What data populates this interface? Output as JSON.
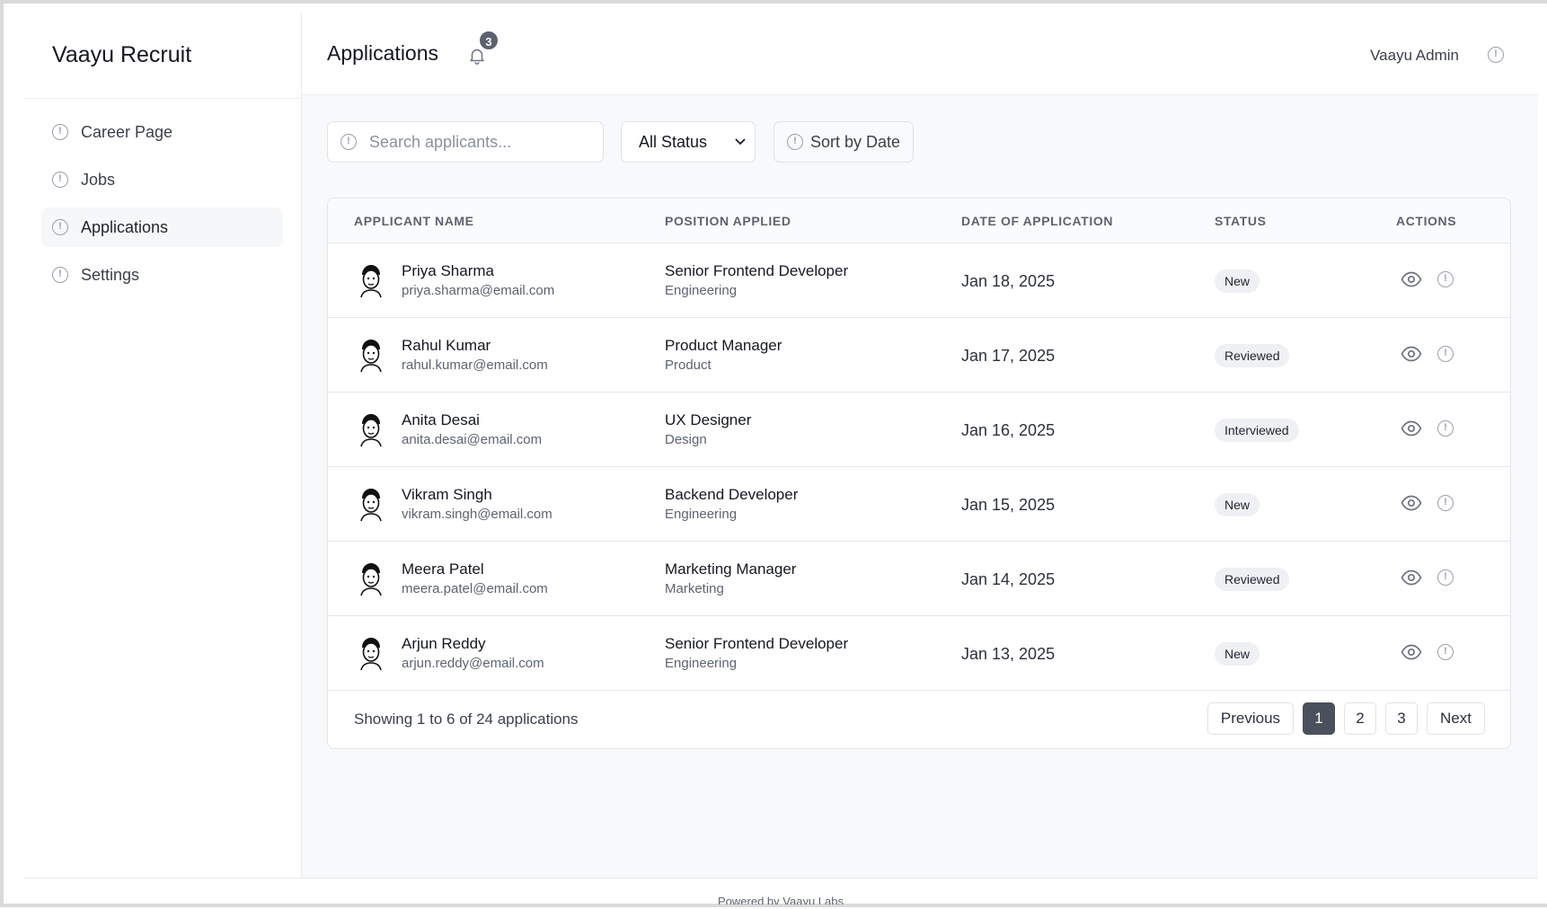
{
  "app": {
    "brand": "Vaayu Recruit"
  },
  "sidebar": {
    "items": [
      {
        "label": "Career Page",
        "icon": "info-circle-icon",
        "active": false
      },
      {
        "label": "Jobs",
        "icon": "info-circle-icon",
        "active": false
      },
      {
        "label": "Applications",
        "icon": "info-circle-icon",
        "active": true
      },
      {
        "label": "Settings",
        "icon": "info-circle-icon",
        "active": false
      }
    ]
  },
  "header": {
    "title": "Applications",
    "notification_count": "3",
    "user_name": "Vaayu Admin"
  },
  "toolbar": {
    "search_placeholder": "Search applicants...",
    "status_filter": "All Status",
    "sort_label": "Sort by Date"
  },
  "table": {
    "columns": [
      "APPLICANT NAME",
      "POSITION APPLIED",
      "DATE OF APPLICATION",
      "STATUS",
      "ACTIONS"
    ],
    "rows": [
      {
        "name": "Priya Sharma",
        "email": "priya.sharma@email.com",
        "position": "Senior Frontend Developer",
        "department": "Engineering",
        "date": "Jan 18, 2025",
        "status": "New"
      },
      {
        "name": "Rahul Kumar",
        "email": "rahul.kumar@email.com",
        "position": "Product Manager",
        "department": "Product",
        "date": "Jan 17, 2025",
        "status": "Reviewed"
      },
      {
        "name": "Anita Desai",
        "email": "anita.desai@email.com",
        "position": "UX Designer",
        "department": "Design",
        "date": "Jan 16, 2025",
        "status": "Interviewed"
      },
      {
        "name": "Vikram Singh",
        "email": "vikram.singh@email.com",
        "position": "Backend Developer",
        "department": "Engineering",
        "date": "Jan 15, 2025",
        "status": "New"
      },
      {
        "name": "Meera Patel",
        "email": "meera.patel@email.com",
        "position": "Marketing Manager",
        "department": "Marketing",
        "date": "Jan 14, 2025",
        "status": "Reviewed"
      },
      {
        "name": "Arjun Reddy",
        "email": "arjun.reddy@email.com",
        "position": "Senior Frontend Developer",
        "department": "Engineering",
        "date": "Jan 13, 2025",
        "status": "New"
      }
    ]
  },
  "pagination": {
    "summary": "Showing 1 to 6 of 24 applications",
    "previous": "Previous",
    "pages": [
      "1",
      "2",
      "3"
    ],
    "current": "1",
    "next": "Next"
  },
  "footer": {
    "text": "Powered by Vaayu Labs"
  }
}
